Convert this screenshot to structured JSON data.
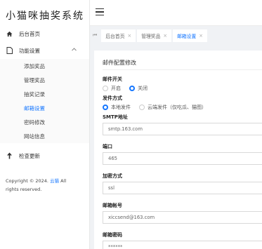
{
  "sidebar": {
    "brand": "小猫咪抽奖系统",
    "items": [
      {
        "label": "后台首页"
      },
      {
        "label": "功能设置"
      },
      {
        "label": "检查更新"
      }
    ],
    "submenu": [
      {
        "label": "添加奖品"
      },
      {
        "label": "管理奖品"
      },
      {
        "label": "抽奖记录"
      },
      {
        "label": "邮箱设置"
      },
      {
        "label": "密码修改"
      },
      {
        "label": "网站信息"
      }
    ],
    "copyright_prefix": "Copyright © 2024.",
    "copyright_link": "云猫",
    "copyright_suffix": "All rights reserved."
  },
  "tabs": {
    "scroll_left": "⏮",
    "items": [
      {
        "label": "后台首页"
      },
      {
        "label": "管理奖品"
      },
      {
        "label": "邮箱设置"
      }
    ],
    "close": "×"
  },
  "form": {
    "title": "邮件配置修改",
    "mail_switch": {
      "label": "邮件开关",
      "options": [
        "开启",
        "关闭"
      ],
      "selected": "关闭"
    },
    "send_mode": {
      "label": "发件方式",
      "options": [
        "本地发件",
        "云端发件（仅吃瓜、猫图）"
      ],
      "selected": "本地发件"
    },
    "smtp": {
      "label": "SMTP地址",
      "value": "smtp.163.com"
    },
    "port": {
      "label": "端口",
      "value": "465"
    },
    "encryption": {
      "label": "加密方式",
      "value": "ssl"
    },
    "account": {
      "label": "邮箱帐号",
      "value": "xiccsend@163.com"
    },
    "password": {
      "label": "邮箱密码",
      "value": "******"
    }
  },
  "colors": {
    "accent": "#1677ff",
    "background": "#f0f2f5"
  }
}
